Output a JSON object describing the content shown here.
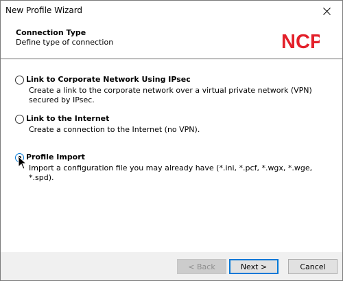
{
  "window": {
    "title": "New Profile Wizard"
  },
  "header": {
    "title": "Connection Type",
    "subtitle": "Define type of connection",
    "logo_text": "NCP",
    "logo_color": "#e3202a"
  },
  "options": [
    {
      "label": "Link to Corporate Network Using IPsec",
      "description": "Create a link to the corporate network over a virtual private network (VPN) secured by IPsec.",
      "selected": false
    },
    {
      "label": "Link to the Internet",
      "description": "Create a connection to the Internet (no VPN).",
      "selected": false
    },
    {
      "label": "Profile Import",
      "description": "Import a configuration file you may already have (*.ini, *.pcf, *.wgx, *.wge, *.spd).",
      "selected": true
    }
  ],
  "buttons": {
    "back": "< Back",
    "next": "Next >",
    "cancel": "Cancel"
  },
  "colors": {
    "accent": "#0078d7",
    "brand": "#e3202a"
  }
}
